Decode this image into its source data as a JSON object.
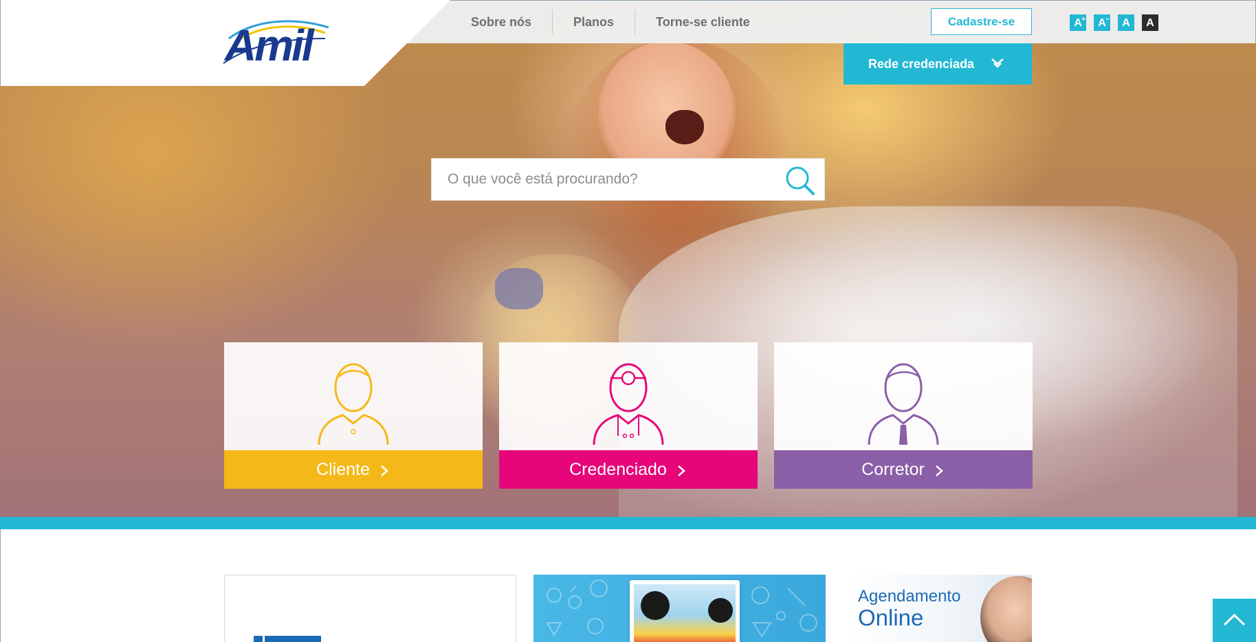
{
  "brand": {
    "name": "Amil"
  },
  "nav": {
    "items": [
      {
        "label": "Sobre nós"
      },
      {
        "label": "Planos"
      },
      {
        "label": "Torne-se cliente"
      }
    ]
  },
  "header": {
    "signup_label": "Cadastre-se",
    "font_controls": [
      {
        "label": "A",
        "suffix": "+",
        "name": "increase-font"
      },
      {
        "label": "A",
        "suffix": "−",
        "name": "decrease-font"
      },
      {
        "label": "A",
        "suffix": "",
        "name": "default-font"
      },
      {
        "label": "A",
        "suffix": "",
        "name": "high-contrast"
      }
    ],
    "rede_label": "Rede credenciada"
  },
  "search": {
    "placeholder": "O que você está procurando?"
  },
  "cards": [
    {
      "label": "Cliente",
      "color": "#f5b819"
    },
    {
      "label": "Credenciado",
      "color": "#e6067a"
    },
    {
      "label": "Corretor",
      "color": "#8b5ea8"
    }
  ],
  "promos": {
    "agendamento": {
      "line1": "Agendamento",
      "line2": "Online"
    }
  },
  "icons": [
    "search-icon",
    "chevron-down-icon",
    "chevron-right-icon",
    "chevron-up-icon",
    "user-icon",
    "doctor-icon",
    "broker-icon"
  ],
  "colors": {
    "accent": "#22b8d4",
    "brand": "#1a3a8f"
  }
}
